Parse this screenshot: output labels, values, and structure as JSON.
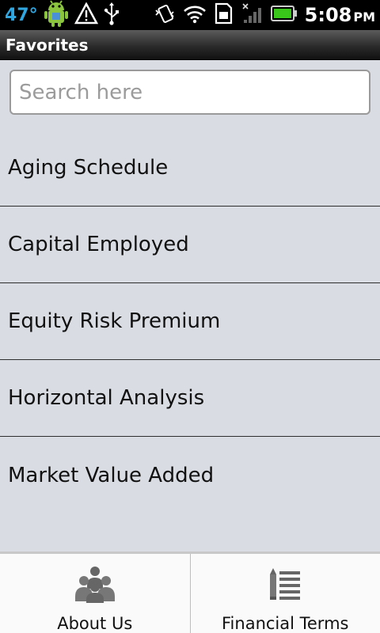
{
  "status_bar": {
    "temperature": "47°",
    "time": "5:08",
    "ampm": "PM"
  },
  "header": {
    "title": "Favorites"
  },
  "search": {
    "placeholder": "Search here",
    "value": ""
  },
  "favorites": {
    "items": [
      {
        "label": "Aging Schedule"
      },
      {
        "label": "Capital Employed"
      },
      {
        "label": "Equity Risk Premium"
      },
      {
        "label": "Horizontal Analysis"
      },
      {
        "label": "Market Value Added"
      }
    ]
  },
  "bottom_nav": {
    "about_label": "About Us",
    "terms_label": "Financial Terms"
  },
  "colors": {
    "accent": "#2fa6e0",
    "battery": "#39c51a",
    "background": "#d9dce3"
  },
  "icons": [
    "android-icon",
    "warning-icon",
    "usb-icon",
    "vibrate-icon",
    "wifi-icon",
    "sim-icon",
    "signal-icon",
    "battery-icon",
    "people-icon",
    "list-pencil-icon"
  ]
}
